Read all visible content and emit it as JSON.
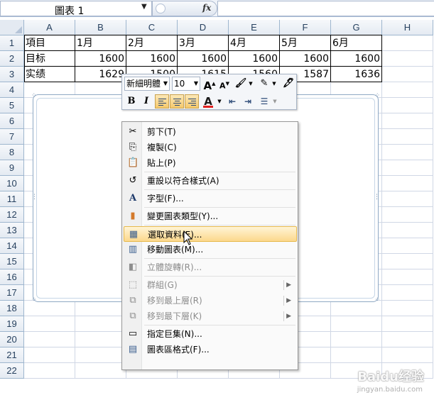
{
  "formula_bar": {
    "name_box": "圖表 1",
    "fx_label": "fx",
    "formula": ""
  },
  "sheet": {
    "columns": [
      "A",
      "B",
      "C",
      "D",
      "E",
      "F",
      "G",
      "H"
    ],
    "rows": [
      "1",
      "2",
      "3",
      "4",
      "5",
      "6",
      "7",
      "8",
      "9",
      "10",
      "11",
      "12",
      "13",
      "14",
      "15",
      "16",
      "17",
      "18",
      "19",
      "20",
      "21",
      "22"
    ],
    "table": [
      [
        "項目",
        "1月",
        "2月",
        "3月",
        "4月",
        "5月",
        "6月"
      ],
      [
        "目标",
        "1600",
        "1600",
        "1600",
        "1600",
        "1600",
        "1600"
      ],
      [
        "实绩",
        "1629",
        "1500",
        "1615",
        "1560",
        "1587",
        "1636"
      ]
    ]
  },
  "mini_toolbar": {
    "font_name": "新細明體",
    "font_size": "10",
    "grow_font": "A",
    "shrink_font": "A",
    "bold": "B",
    "italic": "I",
    "font_color": "A"
  },
  "context_menu": {
    "items": [
      {
        "label": "剪下(T)",
        "icon": "scissors-icon",
        "disabled": false
      },
      {
        "label": "複製(C)",
        "icon": "copy-icon",
        "disabled": false
      },
      {
        "label": "貼上(P)",
        "icon": "paste-icon",
        "disabled": false
      },
      {
        "label": "重設以符合樣式(A)",
        "icon": "reset-style-icon",
        "disabled": false
      },
      {
        "label": "字型(F)...",
        "icon": "font-icon",
        "disabled": false
      },
      {
        "label": "變更圖表類型(Y)...",
        "icon": "chart-type-icon",
        "disabled": false
      },
      {
        "label": "選取資料(E)...",
        "icon": "select-data-icon",
        "disabled": false,
        "highlighted": true
      },
      {
        "label": "移動圖表(M)...",
        "icon": "move-chart-icon",
        "disabled": false
      },
      {
        "label": "立體旋轉(R)...",
        "icon": "3d-rotation-icon",
        "disabled": true
      },
      {
        "label": "群組(G)",
        "icon": "group-icon",
        "disabled": true,
        "submenu": true
      },
      {
        "label": "移到最上層(R)",
        "icon": "bring-to-front-icon",
        "disabled": true,
        "submenu": true
      },
      {
        "label": "移到最下層(K)",
        "icon": "send-to-back-icon",
        "disabled": true,
        "submenu": true
      },
      {
        "label": "指定巨集(N)...",
        "icon": "macro-icon",
        "disabled": false
      },
      {
        "label": "圖表區格式(F)...",
        "icon": "format-chart-area-icon",
        "disabled": false
      }
    ]
  },
  "watermark": {
    "text": "Baidu经验",
    "sub": "jingyan.baidu.com"
  },
  "colors": {
    "header_bg": "#e4eaf2",
    "menu_highlight": "#fcd88c",
    "font_color_bar": "#e02020"
  }
}
